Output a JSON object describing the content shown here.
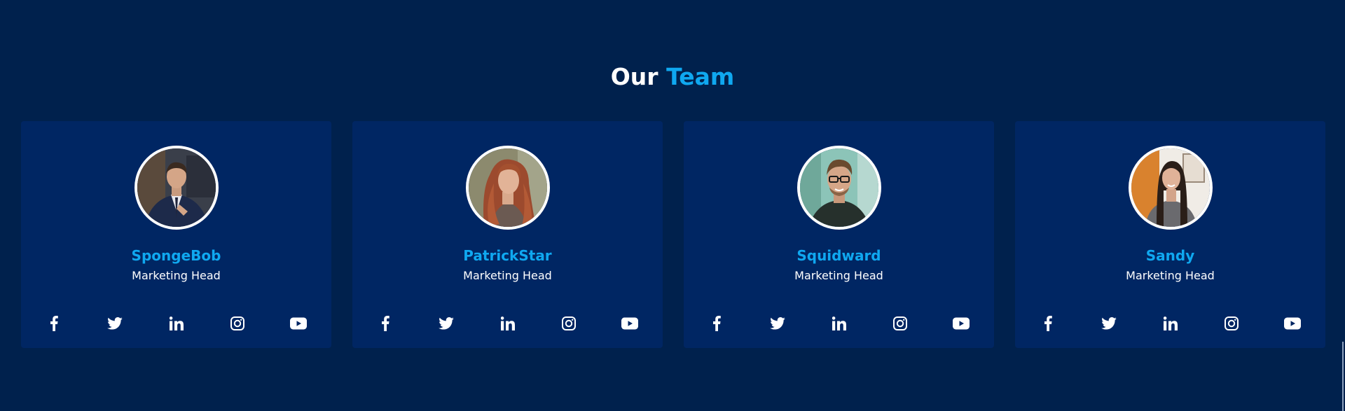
{
  "heading": {
    "part1": "Our",
    "part2": "Team"
  },
  "colors": {
    "background": "#00214d",
    "card": "#002663",
    "accent": "#0fa8f0",
    "text": "#ffffff"
  },
  "members": [
    {
      "name": "SpongeBob",
      "role": "Marketing Head",
      "photo": "man-in-suit-photo"
    },
    {
      "name": "PatrickStar",
      "role": "Marketing Head",
      "photo": "woman-red-hair-photo"
    },
    {
      "name": "Squidward",
      "role": "Marketing Head",
      "photo": "man-with-glasses-photo"
    },
    {
      "name": "Sandy",
      "role": "Marketing Head",
      "photo": "woman-long-hair-photo"
    }
  ],
  "social_icons": [
    "facebook-icon",
    "twitter-icon",
    "linkedin-icon",
    "instagram-icon",
    "youtube-icon"
  ]
}
